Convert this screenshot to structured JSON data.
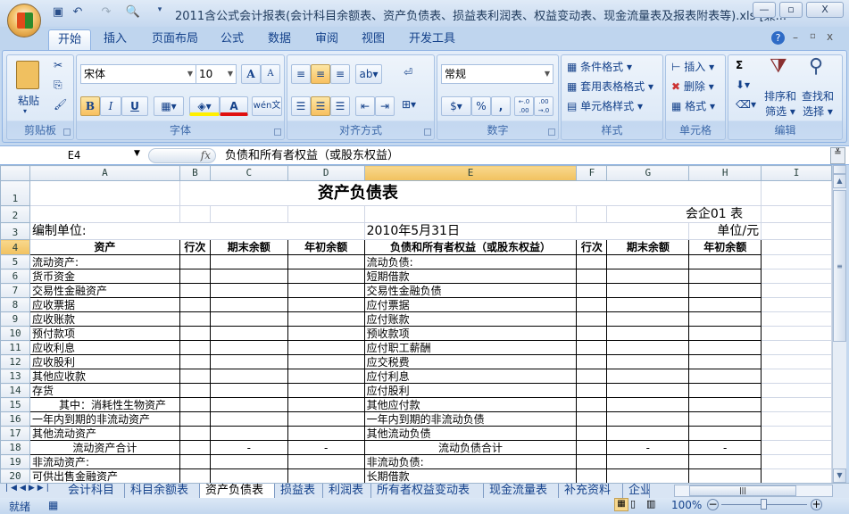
{
  "window": {
    "title": "2011含公式会计报表(会计科目余额表、资产负债表、损益表利润表、权益变动表、现金流量表及报表附表等).xls  [兼...",
    "minimize": "—",
    "restore": "▫",
    "close": "X"
  },
  "ribbon_tabs": [
    "开始",
    "插入",
    "页面布局",
    "公式",
    "数据",
    "审阅",
    "视图",
    "开发工具"
  ],
  "active_tab": "开始",
  "groups": {
    "clipboard": {
      "label": "剪贴板",
      "paste": "粘贴"
    },
    "font": {
      "label": "字体",
      "font_name": "宋体",
      "font_size": "10",
      "bold": "B",
      "italic": "I",
      "underline": "U",
      "grow": "A",
      "shrink": "A",
      "font_color": "A",
      "phonetic": "wén文"
    },
    "alignment": {
      "label": "对齐方式"
    },
    "number": {
      "label": "数字",
      "format": "常规",
      "percent": "%",
      "comma": ",",
      "inc_decimal": "←.0 .00",
      "dec_decimal": ".00 →.0"
    },
    "styles": {
      "label": "样式",
      "conditional": "条件格式",
      "table_format": "套用表格格式",
      "cell_styles": "单元格样式"
    },
    "cells": {
      "label": "单元格",
      "insert": "插入",
      "delete": "删除",
      "format": "格式"
    },
    "editing": {
      "label": "编辑",
      "sum": "Σ",
      "sort_filter_1": "排序和",
      "sort_filter_2": "筛选",
      "find_select_1": "查找和",
      "find_select_2": "选择"
    }
  },
  "formula_bar": {
    "name_box": "E4",
    "fx": "fx",
    "content": "负债和所有者权益（或股东权益）"
  },
  "columns": [
    "A",
    "B",
    "C",
    "D",
    "E",
    "F",
    "G",
    "H",
    "I"
  ],
  "selected_cell": "E4",
  "sheet": {
    "title": "资产负债表",
    "form_no": "会企01 表",
    "compiler": "编制单位:",
    "date": "2010年5月31日",
    "unit": "单位/元",
    "headers": [
      "资产",
      "行次",
      "期末余额",
      "年初余额",
      "负债和所有者权益（或股东权益）",
      "行次",
      "期末余额",
      "年初余额"
    ],
    "rows": [
      [
        "流动资产:",
        "",
        "",
        "",
        "流动负债:",
        "",
        "",
        ""
      ],
      [
        "货币资金",
        "",
        "",
        "",
        "短期借款",
        "",
        "",
        ""
      ],
      [
        "交易性金融资产",
        "",
        "",
        "",
        "交易性金融负债",
        "",
        "",
        ""
      ],
      [
        "应收票据",
        "",
        "",
        "",
        "应付票据",
        "",
        "",
        ""
      ],
      [
        "应收账款",
        "",
        "",
        "",
        "应付账款",
        "",
        "",
        ""
      ],
      [
        "预付款项",
        "",
        "",
        "",
        "预收款项",
        "",
        "",
        ""
      ],
      [
        "应收利息",
        "",
        "",
        "",
        "应付职工薪酬",
        "",
        "",
        ""
      ],
      [
        "应收股利",
        "",
        "",
        "",
        "应交税费",
        "",
        "",
        ""
      ],
      [
        "其他应收款",
        "",
        "",
        "",
        "应付利息",
        "",
        "",
        ""
      ],
      [
        "存货",
        "",
        "",
        "",
        "应付股利",
        "",
        "",
        ""
      ],
      [
        "其中：消耗性生物资产",
        "",
        "",
        "",
        "其他应付款",
        "",
        "",
        ""
      ],
      [
        "一年内到期的非流动资产",
        "",
        "",
        "",
        "一年内到期的非流动负债",
        "",
        "",
        ""
      ],
      [
        "其他流动资产",
        "",
        "",
        "",
        "其他流动负债",
        "",
        "",
        ""
      ],
      [
        "流动资产合计",
        "",
        "-",
        "-",
        "流动负债合计",
        "",
        "-",
        "-"
      ],
      [
        "非流动资产:",
        "",
        "",
        "",
        "非流动负债:",
        "",
        "",
        ""
      ],
      [
        "可供出售金融资产",
        "",
        "",
        "",
        "长期借款",
        "",
        "",
        ""
      ]
    ]
  },
  "sheet_tabs": [
    "会计科目",
    "科目余额表",
    "资产负债表",
    "损益表",
    "利润表",
    "所有者权益变动表",
    "现金流量表",
    "补充资料",
    "企业"
  ],
  "active_sheet": "资产负债表",
  "status": {
    "ready": "就绪",
    "zoom": "100%"
  }
}
